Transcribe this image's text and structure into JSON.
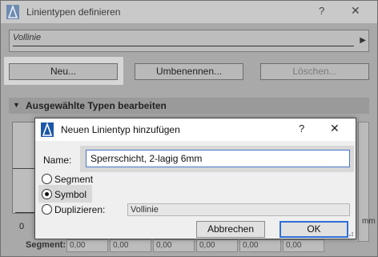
{
  "background_dialog": {
    "title": "Linientypen definieren",
    "help_glyph": "?",
    "close_glyph": "✕",
    "selector_value": "Vollinie",
    "buttons": {
      "new": "Neu...",
      "rename": "Umbenennen...",
      "delete": "Löschen..."
    },
    "section_label": "Ausgewählte Typen bearbeiten",
    "ruler_zero": "0",
    "segment_label": "Segment:",
    "segment_values": [
      "0,00",
      "0,00",
      "0,00",
      "0,00",
      "0,00",
      "0,00"
    ],
    "unit": "mm"
  },
  "modal": {
    "title": "Neuen Linientyp hinzufügen",
    "help_glyph": "?",
    "close_glyph": "✕",
    "name_label": "Name:",
    "name_value": "Sperrschicht, 2-lagig 6mm",
    "options": {
      "segment": "Segment",
      "symbol": "Symbol",
      "duplicate": "Duplizieren:"
    },
    "selected_option": "symbol",
    "duplicate_value": "Vollinie",
    "buttons": {
      "cancel": "Abbrechen",
      "ok": "OK"
    }
  },
  "icons": {
    "app": "archicad-logo-icon",
    "close": "close-icon",
    "help": "help-icon",
    "selector_scroll": "chevron-right-icon",
    "section_toggle": "triangle-down-icon",
    "resize": "resize-grip-icon"
  },
  "colors": {
    "primary_button_border": "#2f6fd6",
    "input_focus_border": "#4a78c8"
  }
}
